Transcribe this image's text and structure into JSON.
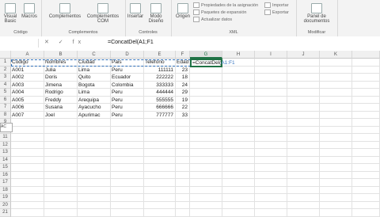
{
  "ribbon": {
    "groups": [
      {
        "label": "Código",
        "buttons": [
          "Visual Basic",
          "Macros"
        ]
      },
      {
        "label": "Complementos",
        "buttons": [
          "Complementos",
          "Complementos COM"
        ]
      },
      {
        "label": "Controles",
        "buttons": [
          "Insertar",
          "Modo Diseño"
        ]
      },
      {
        "label": "XML",
        "buttons": [
          "Origen"
        ],
        "items": [
          "Propiedades de la asignación",
          "Paquetes de expansión",
          "Actualizar datos",
          "Importar",
          "Exportar"
        ]
      },
      {
        "label": "Modificar",
        "buttons": [
          "Panel de documentos"
        ]
      }
    ]
  },
  "formula_bar": {
    "fx": "✕ ✓ fx",
    "formula": "=ConcatDel(A1;F1"
  },
  "columns": [
    "A",
    "B",
    "C",
    "D",
    "E",
    "F",
    "G",
    "H",
    "I",
    "J",
    "K"
  ],
  "rows": [
    [
      "Codigo",
      "Nombres",
      "Ciudad",
      "Pais",
      "Telefono",
      "Edad"
    ],
    [
      "A001",
      "Julia",
      "Lima",
      "Peru",
      "111111",
      "23"
    ],
    [
      "A002",
      "Doris",
      "Quito",
      "Ecuador",
      "222222",
      "18"
    ],
    [
      "A003",
      "Jimena",
      "Bogota",
      "Colombia",
      "333333",
      "24"
    ],
    [
      "A004",
      "Rodrigo",
      "Lima",
      "Peru",
      "444444",
      "29"
    ],
    [
      "A005",
      "Freddy",
      "Arequipa",
      "Peru",
      "555555",
      "19"
    ],
    [
      "A006",
      "Susana",
      "Ayacucho",
      "Peru",
      "666666",
      "22"
    ],
    [
      "A007",
      "Joel",
      "Apurimac",
      "Peru",
      "777777",
      "33"
    ]
  ],
  "active_cell": {
    "prefix": "=ConcatDel(",
    "ref": "A1:F1"
  },
  "side_tip": "AC"
}
